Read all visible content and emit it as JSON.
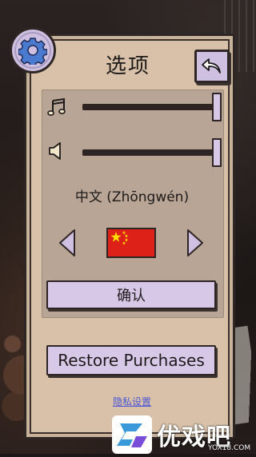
{
  "page": {
    "title": "选项"
  },
  "colors": {
    "panel": "#d8c1a8",
    "inner_panel": "#b8a595",
    "button": "#d6c8e6",
    "outline": "#2e2624",
    "link": "#4b55d6",
    "flag_red": "#dd2118",
    "flag_star": "#ffde00"
  },
  "icons": {
    "settings": "gear-icon",
    "back": "undo-arrow-icon",
    "music": "music-note-icon",
    "sound": "speaker-icon",
    "prev_language": "triangle-left-icon",
    "next_language": "triangle-right-icon"
  },
  "audio": {
    "music_volume": 1.0,
    "sound_volume": 1.0
  },
  "language": {
    "current": "中文 (Zhōngwén)",
    "flag": "china-flag"
  },
  "buttons": {
    "confirm": "确认",
    "restore": "Restore Purchases"
  },
  "links": {
    "privacy": "隐私设置"
  },
  "watermark": {
    "text": "优戏吧",
    "url": "YOX18.COM"
  }
}
